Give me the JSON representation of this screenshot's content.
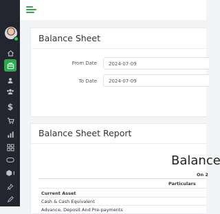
{
  "colors": {
    "sidebar_bg": "#23262f",
    "accent": "#2fa84f",
    "page_bg": "#f2f4f6"
  },
  "topbar": {
    "menu_icon": "hamburger-menu-icon"
  },
  "sidebar": {
    "user": {
      "avatar": "user-avatar",
      "status": "online"
    },
    "items": [
      {
        "icon": "home-icon",
        "active": false
      },
      {
        "icon": "briefcase-icon",
        "active": true
      },
      {
        "icon": "user-icon",
        "active": false
      },
      {
        "icon": "users-icon",
        "active": false
      },
      {
        "icon": "dollar-icon",
        "active": false
      },
      {
        "icon": "cart-icon",
        "active": false
      },
      {
        "icon": "bar-chart-icon",
        "active": false
      },
      {
        "icon": "grid-icon",
        "active": false
      },
      {
        "icon": "toggle-icon",
        "active": false
      },
      {
        "icon": "box-icon",
        "active": false
      },
      {
        "icon": "pin-icon",
        "active": false
      },
      {
        "icon": "pencil-icon",
        "active": false
      }
    ]
  },
  "balance_sheet_form": {
    "title": "Balance Sheet",
    "from_date_label": "From Date",
    "from_date_value": "2024-07-09",
    "to_date_label": "To Date",
    "to_date_value": "2024-07-09"
  },
  "report": {
    "title": "Balance Sheet Report",
    "heading": "Balance",
    "subheading": "On 2",
    "table": {
      "header": "Particulars",
      "rows": [
        {
          "label": "Current Asset",
          "bold": true
        },
        {
          "label": "Cash & Cash Equivalent",
          "bold": false
        },
        {
          "label": "Advance, Deposit And Pre-payments",
          "bold": false
        }
      ]
    }
  }
}
